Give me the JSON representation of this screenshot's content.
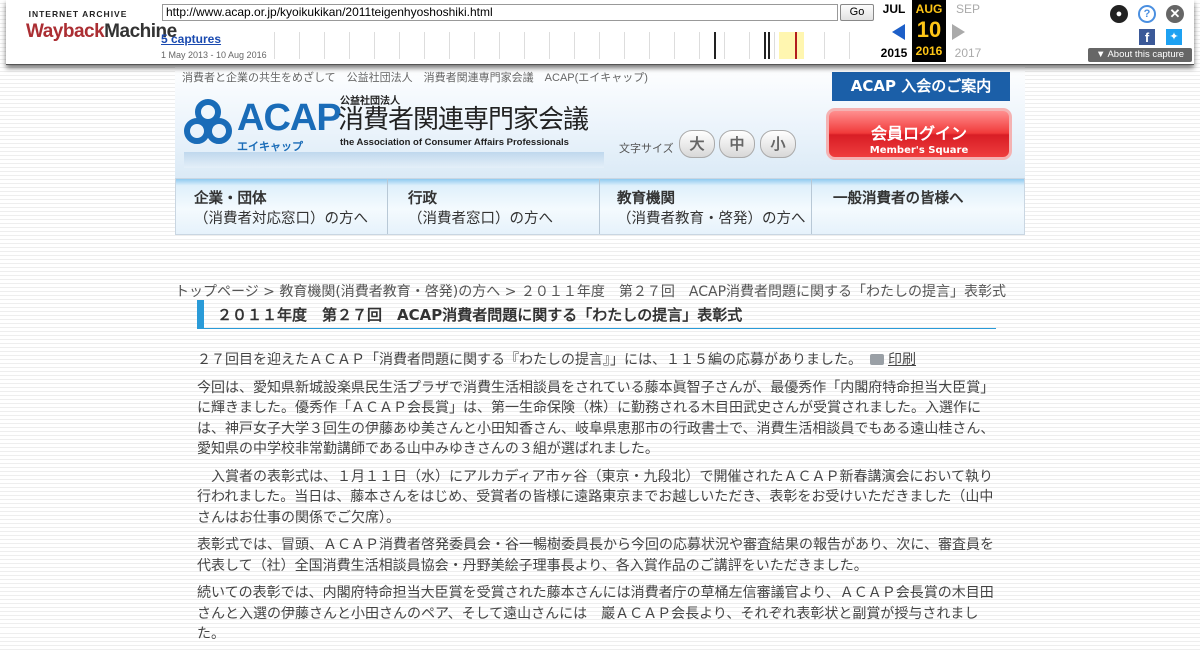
{
  "wayback": {
    "logo_top": "INTERNET ARCHIVE",
    "logo_main_1": "Wayback",
    "logo_main_2": "Machine",
    "url": "http://www.acap.or.jp/kyoikukikan/2011teigenhyoshoshiki.html",
    "go_label": "Go",
    "captures": "5 captures",
    "range": "1 May 2013 - 10 Aug 2016",
    "prev_month": "JUL",
    "cur_month": "AUG",
    "next_month": "SEP",
    "cur_day": "10",
    "prev_year": "2015",
    "cur_year": "2016",
    "next_year": "2017",
    "about": "About this capture"
  },
  "header": {
    "tagline": "消費者と企業の共生をめざして　公益社団法人　消費者関連専門家会議　ACAP(エイキャップ)",
    "logo_en": "ACAP",
    "logo_kana": "エイキャップ",
    "logo_corp": "公益社団法人",
    "logo_ja": "消費者関連専門家会議",
    "logo_sub": "the Association of Consumer Affairs Professionals",
    "font_size_label": "文字サイズ",
    "font_large": "大",
    "font_medium": "中",
    "font_small": "小",
    "join": "ACAP 入会のご案内",
    "login": "会員ログイン",
    "login_sub": "Member's Square"
  },
  "nav": [
    {
      "line1": "企業・団体",
      "line2": "（消費者対応窓口）の方へ"
    },
    {
      "line1": "行政",
      "line2": "（消費者窓口）の方へ"
    },
    {
      "line1": "教育機関",
      "line2": "（消費者教育・啓発）の方へ"
    },
    {
      "line1": "一般消費者の皆様へ",
      "line2": ""
    }
  ],
  "breadcrumb": "トップページ > 教育機関(消費者教育・啓発)の方へ > ２０１１年度　第２７回　ACAP消費者問題に関する「わたしの提言」表彰式",
  "page_title": "２０１１年度　第２７回　ACAP消費者問題に関する「わたしの提言」表彰式",
  "print_label": "印刷",
  "paragraphs": [
    "２７回目を迎えたＡＣＡＰ「消費者問題に関する『わたしの提言』」には、１１５編の応募がありました。",
    "今回は、愛知県新城設楽県民生活プラザで消費生活相談員をされている藤本眞智子さんが、最優秀作「内閣府特命担当大臣賞」に輝きました。優秀作「ＡＣＡＰ会長賞」は、第一生命保険（株）に勤務される木目田武史さんが受賞されました。入選作には、神戸女子大学３回生の伊藤あゆ美さんと小田知香さん、岐阜県恵那市の行政書士で、消費生活相談員でもある遠山桂さん、愛知県の中学校非常勤講師である山中みゆきさんの３組が選ばれました。",
    "　入賞者の表彰式は、１月１１日（水）にアルカディア市ヶ谷（東京・九段北）で開催されたＡＣＡＰ新春講演会において執り行われました。当日は、藤本さんをはじめ、受賞者の皆様に遠路東京までお越しいただき、表彰をお受けいただきました（山中さんはお仕事の関係でご欠席）。",
    "表彰式では、冒頭、ＡＣＡＰ消費者啓発委員会・谷一暢樹委員長から今回の応募状況や審査結果の報告があり、次に、審査員を代表して（社）全国消費生活相談員協会・丹野美絵子理事長より、各入賞作品のご講評をいただきました。",
    "続いての表彰では、内閣府特命担当大臣賞を受賞された藤本さんには消費者庁の草桶左信審議官より、ＡＣＡＰ会長賞の木目田さんと入選の伊藤さんと小田さんのペア、そして遠山さんには　巖ＡＣＡＰ会長より、それぞれ表彰状と副賞が授与されました。"
  ],
  "colors": {
    "acap_blue": "#1a6cb8",
    "title_accent": "#2a9bd8",
    "login_red": "#e8262e",
    "wayback_highlight": "#fec516"
  }
}
